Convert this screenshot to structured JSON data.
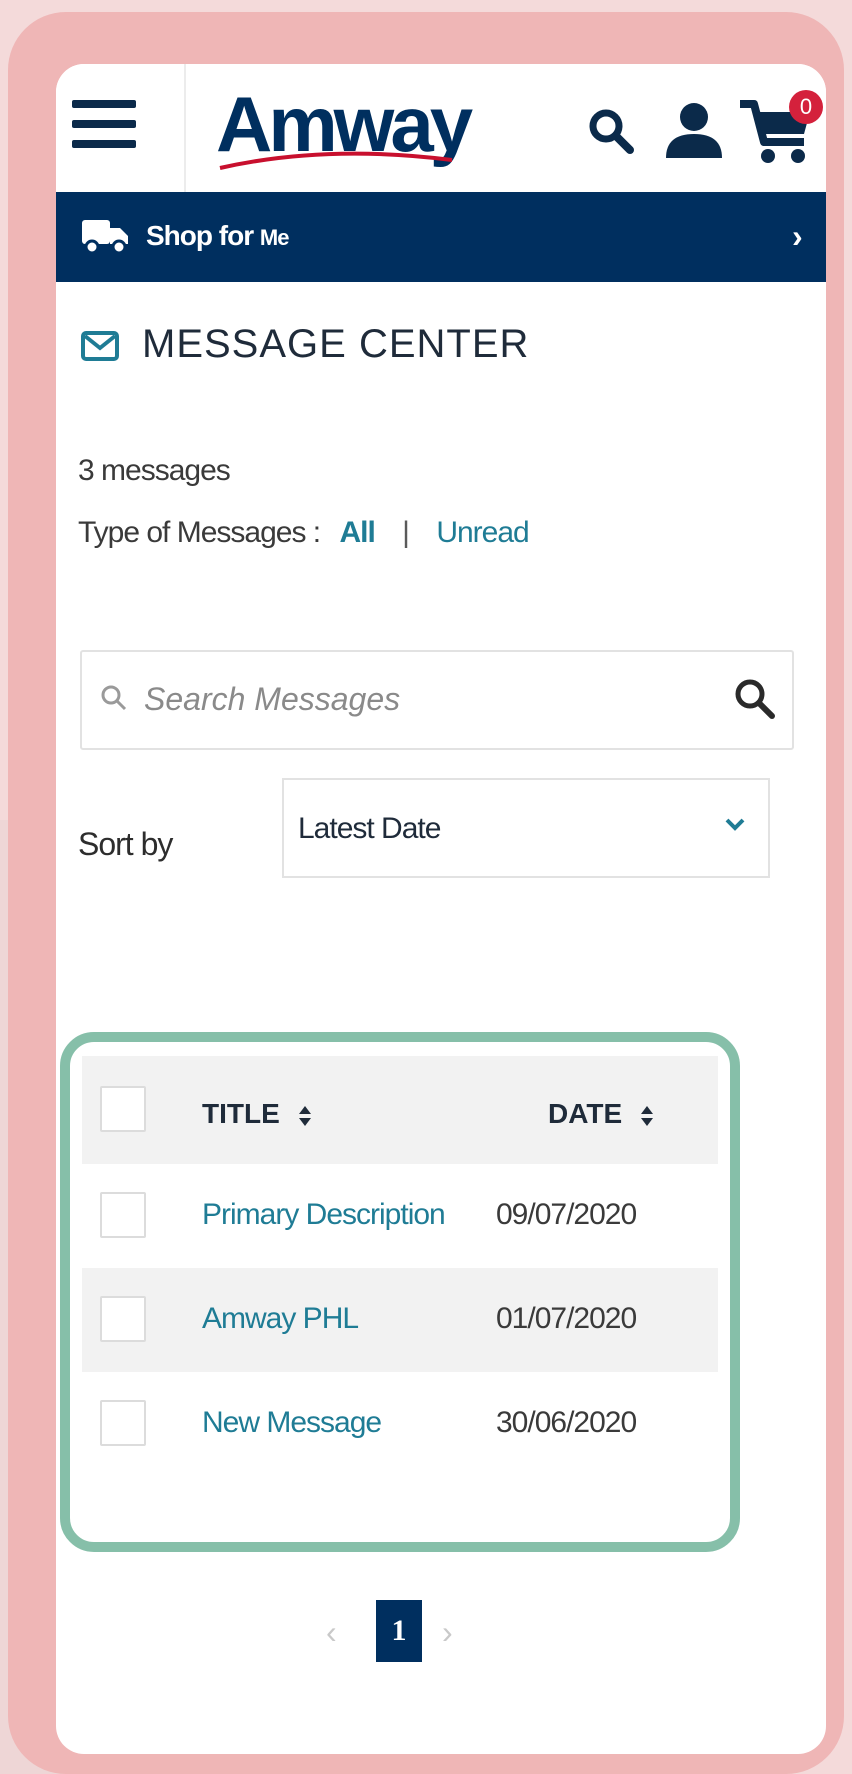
{
  "header": {
    "brand": "Amway",
    "cart_count": "0",
    "colors": {
      "brand_navy": "#002f5f",
      "logo_swoosh": "#c8102e",
      "badge_red": "#d4213c"
    }
  },
  "shop_bar": {
    "label": "Shop for",
    "label_suffix": "Me",
    "arrow": "›",
    "icon": "truck-icon"
  },
  "message_center": {
    "title": "MESSAGE CENTER",
    "icon": "envelope-icon",
    "count_text": "3 messages",
    "type_label": "Type of Messages :",
    "filter_all": "All",
    "filter_sep": "|",
    "filter_unread": "Unread"
  },
  "search": {
    "placeholder": "Search Messages"
  },
  "sort": {
    "label": "Sort by",
    "selected": "Latest Date"
  },
  "table": {
    "columns": {
      "title": "TITLE",
      "date": "DATE"
    },
    "rows": [
      {
        "title": "Primary Description",
        "date": "09/07/2020"
      },
      {
        "title": "Amway PHL",
        "date": "01/07/2020"
      },
      {
        "title": "New Message",
        "date": "30/06/2020"
      }
    ]
  },
  "pagination": {
    "prev": "‹",
    "current": "1",
    "next": "›"
  },
  "colors": {
    "frame_pink": "#efb6b6",
    "highlight_green": "#86bfa9",
    "link_teal": "#1f7c95"
  }
}
